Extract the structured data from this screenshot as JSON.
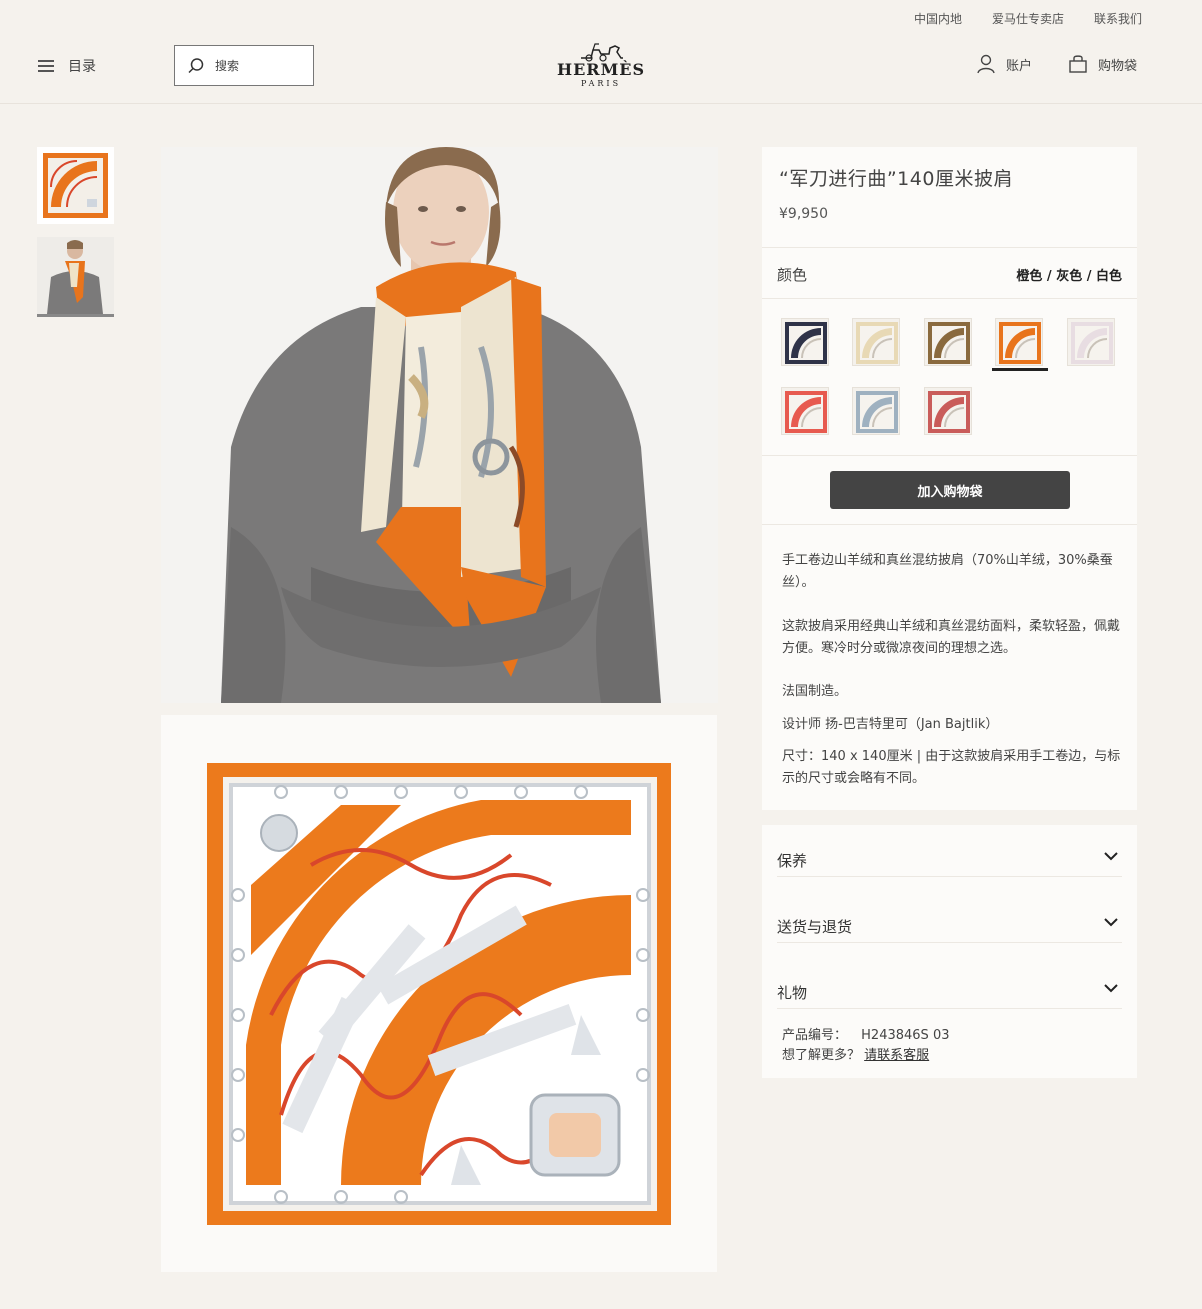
{
  "util_links": [
    "中国内地",
    "爱马仕专卖店",
    "联系我们"
  ],
  "header": {
    "menu_label": "目录",
    "search_placeholder": "搜索",
    "logo_brand": "HERMÈS",
    "logo_city": "PARIS",
    "account_label": "账户",
    "bag_label": "购物袋"
  },
  "product": {
    "title": "“军刀进行曲”140厘米披肩",
    "price": "¥9,950",
    "color_label": "颜色",
    "color_value": "橙色 / 灰色 / 白色",
    "swatches": [
      {
        "name": "navy-brown",
        "accent": "#2f3348",
        "selected": false
      },
      {
        "name": "beige",
        "accent": "#e8d9b5",
        "selected": false
      },
      {
        "name": "brown-gold",
        "accent": "#8a6a3e",
        "selected": false
      },
      {
        "name": "orange-grey-white",
        "accent": "#e8741c",
        "selected": true
      },
      {
        "name": "pale-grey-pink",
        "accent": "#e8dde2",
        "selected": false
      },
      {
        "name": "red-pink",
        "accent": "#e75a4f",
        "selected": false
      },
      {
        "name": "blue-grey",
        "accent": "#9fb1c0",
        "selected": false
      },
      {
        "name": "rose-red",
        "accent": "#c95c5a",
        "selected": false
      }
    ],
    "add_to_bag": "加入购物袋",
    "desc": {
      "p1": "手工卷边山羊绒和真丝混纺披肩（70%山羊绒，30%桑蚕丝）。",
      "p2": "这款披肩采用经典山羊绒和真丝混纺面料，柔软轻盈，佩戴方便。寒冷时分或微凉夜间的理想之选。",
      "p3": "法国制造。",
      "p4": "设计师 扬-巴吉特里可（Jan Bajtlik）",
      "p5": "尺寸：140 x 140厘米 | 由于这款披肩采用手工卷边，与标示的尺寸或会略有不同。"
    }
  },
  "accordion": {
    "care": "保养",
    "shipping": "送货与退货",
    "gift": "礼物"
  },
  "meta": {
    "ref_label": "产品编号：",
    "ref_value": "H243846S 03",
    "more_label": "想了解更多？",
    "contact_link": "请联系客服"
  },
  "colors": {
    "orange": "#e8741c",
    "button": "#444444",
    "background": "#f5f2ed"
  }
}
